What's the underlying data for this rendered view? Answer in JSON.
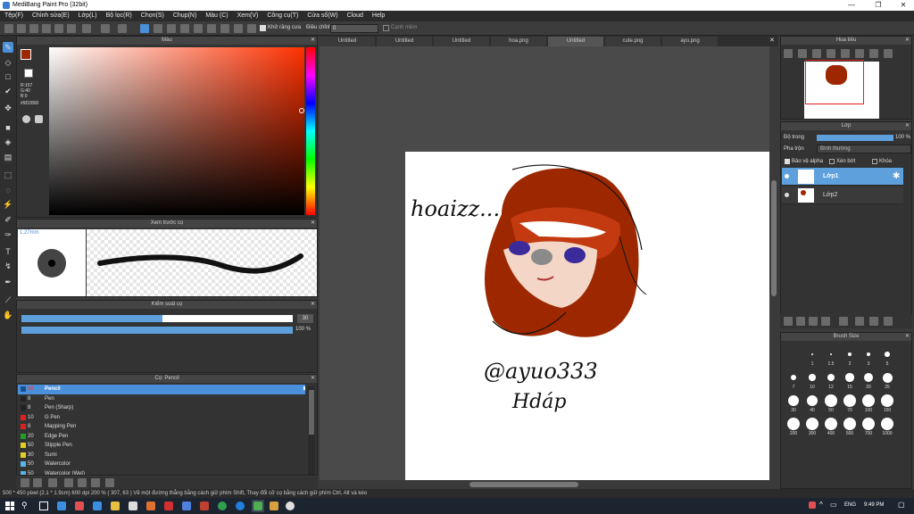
{
  "window": {
    "title": "MediBang Paint Pro (32bit)"
  },
  "menu": [
    "Tệp(F)",
    "Chỉnh sửa(E)",
    "Lớp(L)",
    "Bộ lọc(R)",
    "Chọn(S)",
    "Chụp(N)",
    "Màu (C)",
    "Xem(V)",
    "Công cụ(T)",
    "Cửa sổ(W)",
    "Cloud",
    "Help"
  ],
  "toolbar": {
    "antialias_label": "Khử răng cưa",
    "adjust_label": "Điều chỉnh",
    "adjust_value": "0",
    "smooth_label": "Cạnh mềm"
  },
  "color_panel": {
    "title": "Màu",
    "r": "R:157",
    "g": "G:40",
    "b": "B:0",
    "hex": "#9D2800",
    "primary": "#9D2800"
  },
  "brush_preview": {
    "title": "Xem trước cọ",
    "size": "1.27mm"
  },
  "brush_control": {
    "title": "Kiểm soát cọ",
    "size_value": "30",
    "opacity_value": "100 %",
    "size_fraction": 0.52,
    "opacity_fraction": 1.0
  },
  "brush_list": {
    "title": "Cọ: Pencil",
    "items": [
      {
        "size": "30",
        "name": "Pencil",
        "color": "#1a4f8c"
      },
      {
        "size": "8",
        "name": "Pen",
        "color": "#222222"
      },
      {
        "size": "8",
        "name": "Pen (Sharp)",
        "color": "#222222"
      },
      {
        "size": "10",
        "name": "G Pen",
        "color": "#e02020"
      },
      {
        "size": "8",
        "name": "Mapping Pen",
        "color": "#e02020"
      },
      {
        "size": "20",
        "name": "Edge Pen",
        "color": "#20a020"
      },
      {
        "size": "50",
        "name": "Stipple Pen",
        "color": "#e0d020"
      },
      {
        "size": "30",
        "name": "Sumi",
        "color": "#e0d020"
      },
      {
        "size": "50",
        "name": "Watercolor",
        "color": "#5ab4e8"
      },
      {
        "size": "50",
        "name": "Watercolor (Wet)",
        "color": "#5ab4e8"
      }
    ]
  },
  "tabs": [
    "Untitled",
    "Untitled",
    "Untitled",
    "hoa.png",
    "Untitled",
    "cute.png",
    "ayu.png"
  ],
  "artwork": {
    "text1": "hoaizz...",
    "text2": "@ayuo333",
    "text3": "Hdáp"
  },
  "navigator": {
    "title": "Hoa tiêu"
  },
  "layers": {
    "title": "Lớp",
    "opacity_label": "Độ trong",
    "opacity_value": "100 %",
    "blend_label": "Pha trộn",
    "blend_value": "Bình thường",
    "protect_alpha": "Bảo vệ alpha",
    "clip": "Xén bớt",
    "lock": "Khóa",
    "items": [
      "Lớp1",
      "Lớp2"
    ]
  },
  "brush_size": {
    "title": "Brush Size",
    "labels": [
      "1",
      "1.5",
      "2",
      "3",
      "5",
      "7",
      "10",
      "12",
      "15",
      "20",
      "25",
      "30",
      "40",
      "50",
      "70",
      "100",
      "150",
      "200",
      "300",
      "400",
      "500",
      "700",
      "1000"
    ]
  },
  "status": {
    "text": "500 * 450 pixel   (2.1 * 1.9cm)   600 dpi   200 %   ( 307, 63 )   Vẽ một đường thẳng bằng cách giữ phím Shift, Thay đổi cỡ cọ bằng cách giữ phím Ctrl, Alt và kéo"
  },
  "taskbar": {
    "lang": "ENG",
    "time": "9:49 PM"
  }
}
